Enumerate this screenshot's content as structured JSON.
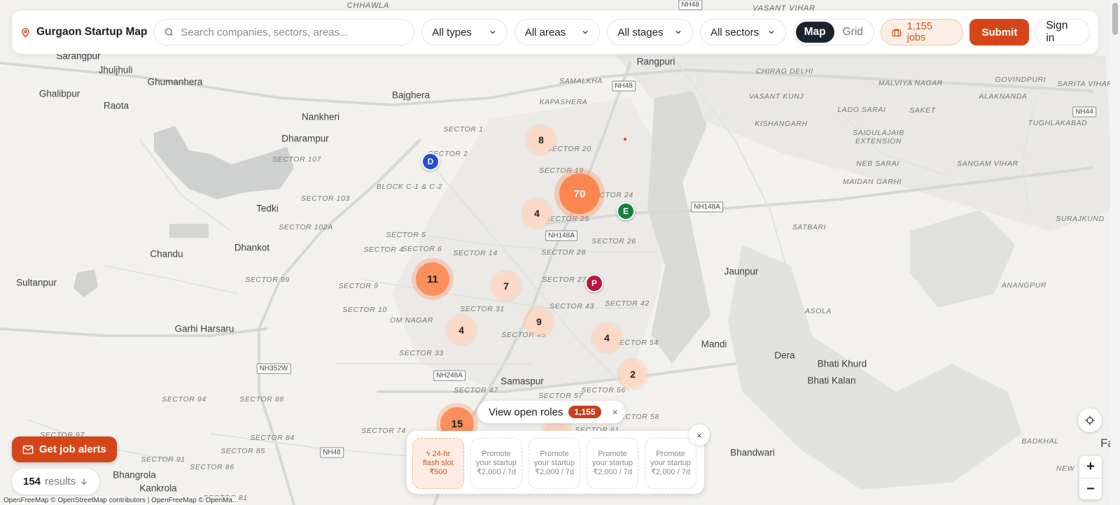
{
  "header": {
    "brand": "Gurgaon Startup Map",
    "search_placeholder": "Search companies, sectors, areas...",
    "filters": {
      "types": "All types",
      "areas": "All areas",
      "stages": "All stages",
      "sectors": "All sectors"
    },
    "view_map": "Map",
    "view_grid": "Grid",
    "jobs_label": "1,155 jobs",
    "submit_label": "Submit",
    "signin_label": "Sign in"
  },
  "map": {
    "places": [
      "CHHAWLA",
      "NH48",
      "VASANT VIHAR",
      "Sarangpur",
      "Jhuljhuli",
      "Ghumanhera",
      "Rangpuri",
      "SAMALKHA",
      "CHIRAG DELHI",
      "Ghalibpur",
      "Raota",
      "Bajghera",
      "KAPASHERA",
      "VASANT KUNJ",
      "MALVIYA NAGAR",
      "GOVINDPURI",
      "SARITA VIHAR",
      "ALAKNANDA",
      "Nankheri",
      "LADO SARAI",
      "SAKET",
      "Dharampur",
      "KISHANGARH",
      "SAIDULAJAIB EXTENSION",
      "TUGHLAKABAD",
      "NEB SARAI",
      "SANGAM VIHAR",
      "MAIDAN GARHI",
      "Tedki",
      "SATBARI",
      "SURAJKUND",
      "Chandu",
      "Dhankot",
      "Jaunpur",
      "Sultanpur",
      "ANANGPUR",
      "ASOLA",
      "Garhi Harsaru",
      "Mandi",
      "Dera",
      "Bhati Khurd",
      "Bhati Kalan",
      "Samaspur",
      "Bhandwari",
      "BADKHAL",
      "Bhangrola",
      "Kankrola",
      "NEW",
      "Fa"
    ],
    "sectors": [
      "SECTOR 1",
      "SECTOR 2",
      "SECTOR 107",
      "SECTOR 20",
      "SECTOR 19",
      "BLOCK C-1 & C-2",
      "SECTOR 103",
      "SECTOR 24",
      "SECTOR 25",
      "SECTOR 102A",
      "SECTOR 5",
      "SECTOR 4",
      "SECTOR 6",
      "SECTOR 14",
      "SECTOR 26",
      "SECTOR 28",
      "SECTOR 99",
      "SECTOR 9",
      "SECTOR 27",
      "SECTOR 10",
      "OM NAGAR",
      "SECTOR 31",
      "SECTOR 43",
      "SECTOR 42",
      "SECTOR 45",
      "SECTOR 54",
      "SECTOR 33",
      "SECTOR 47",
      "SECTOR 56",
      "SECTOR 94",
      "SECTOR 88",
      "SECTOR 57",
      "SECTOR 58",
      "SECTOR 97",
      "SECTOR 84",
      "SECTOR 74",
      "SECTOR 61",
      "SECTOR 91",
      "SECTOR 85",
      "SECTOR 86",
      "SECTOR 81"
    ],
    "shields": [
      "NH48",
      "NH148A",
      "NH148A",
      "NH44",
      "NH352W",
      "NH248A",
      "NH48"
    ],
    "clusters": [
      "8",
      "70",
      "4",
      "11",
      "7",
      "9",
      "4",
      "4",
      "2",
      "15",
      "4"
    ],
    "pins": [
      {
        "letter": "D",
        "color": "#1d4ed8"
      },
      {
        "letter": "E",
        "color": "#15803d"
      },
      {
        "letter": "P",
        "color": "#be123c"
      }
    ],
    "attribution": "OpenFreeMap © OpenStreetMap contributors | OpenFreeMap © OpenMa..."
  },
  "bottom": {
    "alerts_label": "Get job alerts",
    "results_count": "154",
    "results_label": "results",
    "roles_label": "View open roles",
    "roles_count": "1,155",
    "roles_close": "×",
    "promo_close": "×",
    "flash_slot": {
      "line1": "24-hr",
      "line2": "flash slot",
      "line3": "₹500"
    },
    "promo_slots": [
      {
        "line1": "Promote",
        "line2": "your startup",
        "line3": "₹2,000 / 7d"
      },
      {
        "line1": "Promote",
        "line2": "your startup",
        "line3": "₹2,000 / 7d"
      },
      {
        "line1": "Promote",
        "line2": "your startup",
        "line3": "₹2,000 / 7d"
      },
      {
        "line1": "Promote",
        "line2": "your startup",
        "line3": "₹2,000 / 7d"
      }
    ]
  },
  "controls": {
    "zoom_in": "+",
    "zoom_out": "−"
  },
  "colors": {
    "accent": "#d4461a",
    "cluster_light": "#fcd9c6",
    "cluster_strong": "#fb8650",
    "map_bg": "#f2f1ee"
  }
}
